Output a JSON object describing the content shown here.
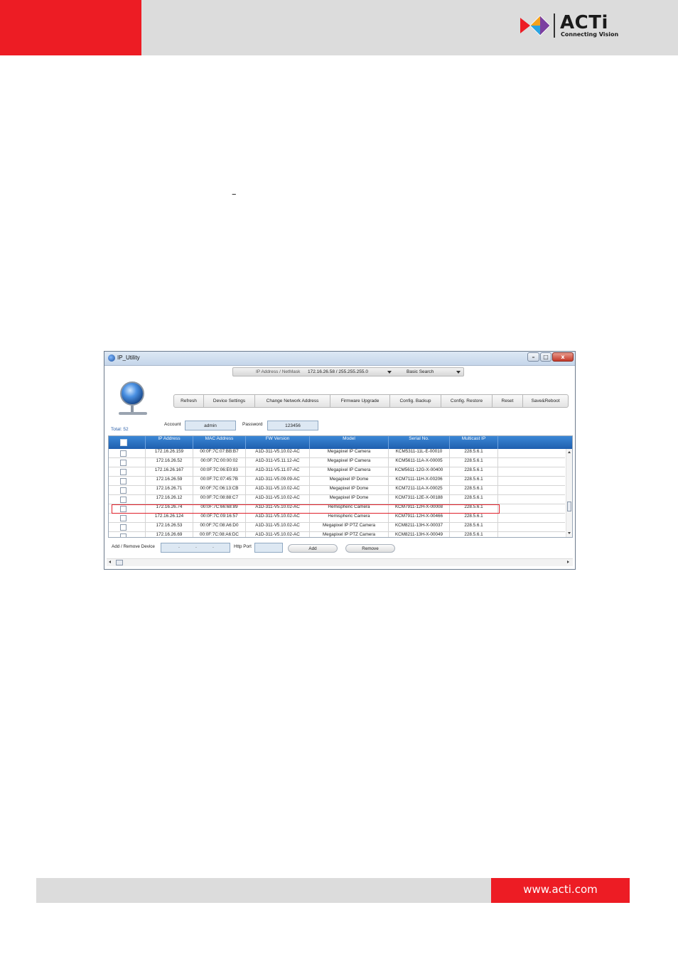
{
  "brand": {
    "name": "ACTi",
    "tagline": "Connecting Vision",
    "colors": {
      "red": "#ed1c24",
      "gray": "#dcdcdc"
    }
  },
  "body_marks": {
    "dash": "–"
  },
  "window": {
    "title": "IP_Utility",
    "controls": {
      "minimize": "–",
      "maximize": "□",
      "close": "x"
    },
    "search": {
      "label": "IP Address / NetMask",
      "value": "172.16.26.58 / 255.255.255.0",
      "mode": "Basic Search"
    },
    "toolbar": {
      "buttons": [
        "Refresh",
        "Device Settings",
        "Change Network Address",
        "Firmware Upgrade",
        "Config. Backup",
        "Config. Restore",
        "Reset",
        "Save&Reboot"
      ]
    },
    "credentials": {
      "account_label": "Account",
      "account_value": "admin",
      "password_label": "Password",
      "password_value": "123456"
    },
    "total": "Total: 52",
    "table": {
      "columns": [
        "IP Address",
        "MAC Address",
        "FW Version",
        "Model",
        "Serial No.",
        "Multicast IP"
      ],
      "rows": [
        [
          "172.16.26.159",
          "00:0F:7C:07:BB:B7",
          "A1D-311-V5.10.02-AC",
          "Megapixel IP Camera",
          "KCM5311-11L-E-00010",
          "228.5.6.1"
        ],
        [
          "172.16.26.52",
          "00:0F:7C:00:00:02",
          "A1D-311-V5.11.12-AC",
          "Megapixel IP Camera",
          "KCM5611-11A-X-00005",
          "228.5.6.1"
        ],
        [
          "172.16.26.167",
          "00:0F:7C:06:E0:83",
          "A1D-311-V5.11.07-AC",
          "Megapixel IP Camera",
          "KCM5611-12G-X-00400",
          "228.5.6.1"
        ],
        [
          "172.16.26.59",
          "00:0F:7C:07:45:7B",
          "A1D-311-V5.09.09-AC",
          "Megapixel IP Dome",
          "KCM7111-11H-X-00206",
          "228.5.6.1"
        ],
        [
          "172.16.26.71",
          "00:0F:7C:06:13:CB",
          "A1D-311-V5.10.02-AC",
          "Megapixel IP Dome",
          "KCM7211-11A-X-00025",
          "228.5.6.1"
        ],
        [
          "172.16.26.12",
          "00:0F:7C:08:88:C7",
          "A1D-311-V5.10.02-AC",
          "Megapixel IP Dome",
          "KCM7311-12E-X-00188",
          "228.5.6.1"
        ],
        [
          "172.16.26.74",
          "00:0F:7C:66:68:89",
          "A1D-311-V5.10.02-AC",
          "Hemispheric Camera",
          "KCM7911-12H-X-00008",
          "228.5.6.1"
        ],
        [
          "172.16.26.124",
          "00:0F:7C:09:16:57",
          "A1D-311-V5.10.02-AC",
          "Hemispheric Camera",
          "KCM7911-12H-X-00466",
          "228.5.6.1"
        ],
        [
          "172.16.26.53",
          "00:0F:7C:08:A6:D0",
          "A1D-311-V5.10.02-AC",
          "Megapixel IP PTZ Camera",
          "KCM8211-13H-X-00037",
          "228.5.6.1"
        ],
        [
          "172.16.26.69",
          "00:0F:7C:08:A6:DC",
          "A1D-311-V5.10.02-AC",
          "Megapixel IP PTZ Camera",
          "KCM8211-13H-X-00049",
          "228.5.6.1"
        ]
      ],
      "highlighted_row_ip": "172.16.26.74",
      "highlight_color": "#e0212b"
    },
    "add_remove": {
      "label": "Add / Remove Device",
      "ip_dots": [
        ".",
        ".",
        "."
      ],
      "port_label": "Http Port",
      "add": "Add",
      "remove": "Remove"
    }
  },
  "footer": {
    "url": "www.acti.com"
  }
}
